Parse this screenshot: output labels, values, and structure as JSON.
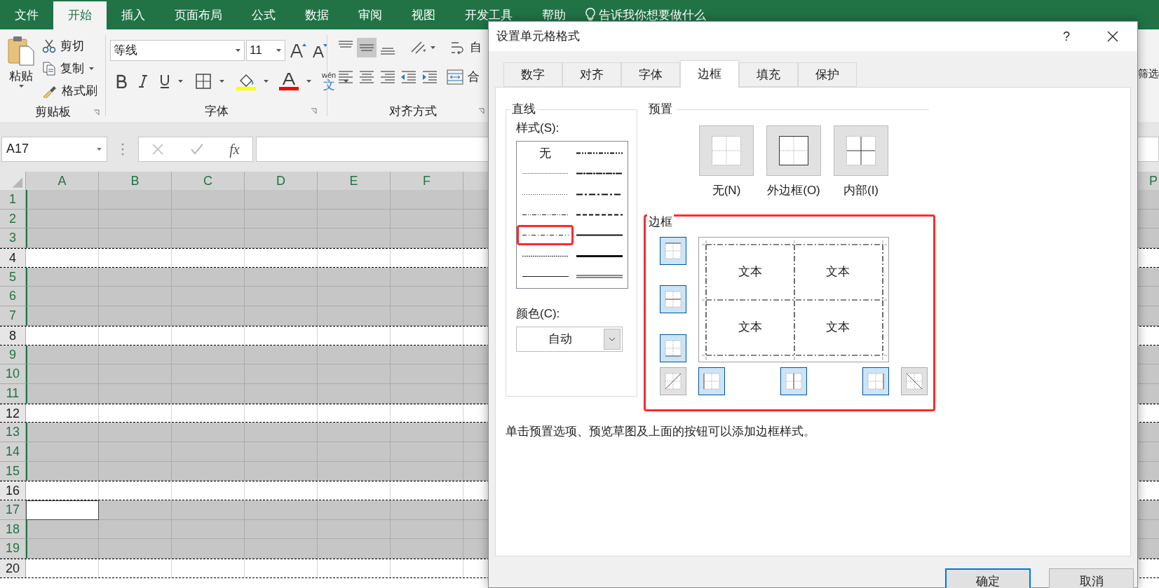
{
  "ribbon_tabs": [
    {
      "label": "文件",
      "selected": false
    },
    {
      "label": "开始",
      "selected": true
    },
    {
      "label": "插入",
      "selected": false
    },
    {
      "label": "页面布局",
      "selected": false
    },
    {
      "label": "公式",
      "selected": false
    },
    {
      "label": "数据",
      "selected": false
    },
    {
      "label": "审阅",
      "selected": false
    },
    {
      "label": "视图",
      "selected": false
    },
    {
      "label": "开发工具",
      "selected": false
    },
    {
      "label": "帮助",
      "selected": false
    }
  ],
  "tell_me": "告诉我你想要做什么",
  "ribbon": {
    "clipboard": {
      "paste": "粘贴",
      "cut": "剪切",
      "copy": "复制",
      "format_painter": "格式刷",
      "label": "剪贴板"
    },
    "font": {
      "name": "等线",
      "size": "11",
      "phonetic_top": "wén",
      "phonetic_char": "文",
      "label": "字体"
    },
    "alignment": {
      "wrap": "自",
      "merge": "合",
      "label": "对齐方式"
    },
    "right_edge": "筛选"
  },
  "name_box": "A17",
  "formula_bar": {
    "fx": "fx"
  },
  "sheet": {
    "columns": [
      "A",
      "B",
      "C",
      "D",
      "E",
      "F"
    ],
    "right_column": "P",
    "rows": [
      {
        "number": "1",
        "shaded": true,
        "active": false
      },
      {
        "number": "2",
        "shaded": true,
        "active": false
      },
      {
        "number": "3",
        "shaded": true,
        "active": false
      },
      {
        "number": "4",
        "shaded": false,
        "active": false
      },
      {
        "number": "5",
        "shaded": true,
        "active": false
      },
      {
        "number": "6",
        "shaded": true,
        "active": false
      },
      {
        "number": "7",
        "shaded": true,
        "active": false
      },
      {
        "number": "8",
        "shaded": false,
        "active": false
      },
      {
        "number": "9",
        "shaded": true,
        "active": false
      },
      {
        "number": "10",
        "shaded": true,
        "active": false
      },
      {
        "number": "11",
        "shaded": true,
        "active": false
      },
      {
        "number": "12",
        "shaded": false,
        "active": false
      },
      {
        "number": "13",
        "shaded": true,
        "active": false
      },
      {
        "number": "14",
        "shaded": true,
        "active": false
      },
      {
        "number": "15",
        "shaded": true,
        "active": false
      },
      {
        "number": "16",
        "shaded": false,
        "active": false
      },
      {
        "number": "17",
        "shaded": true,
        "active": true
      },
      {
        "number": "18",
        "shaded": true,
        "active": false
      },
      {
        "number": "19",
        "shaded": true,
        "active": false
      },
      {
        "number": "20",
        "shaded": false,
        "active": false
      }
    ]
  },
  "dialog": {
    "title": "设置单元格格式",
    "help": "?",
    "tabs": [
      {
        "label": "数字",
        "selected": false
      },
      {
        "label": "对齐",
        "selected": false
      },
      {
        "label": "字体",
        "selected": false
      },
      {
        "label": "边框",
        "selected": true
      },
      {
        "label": "填充",
        "selected": false
      },
      {
        "label": "保护",
        "selected": false
      }
    ],
    "line_group": {
      "label": "直线",
      "style_label": "样式(S):",
      "styles": [
        {
          "kind": "none",
          "label": "无",
          "selected": false
        },
        {
          "kind": "hair",
          "selected": false
        },
        {
          "kind": "dotted",
          "selected": false
        },
        {
          "kind": "dash-dot-dot",
          "selected": false
        },
        {
          "kind": "dash-dot",
          "selected": true
        },
        {
          "kind": "dashed",
          "selected": false
        },
        {
          "kind": "thin",
          "selected": false
        },
        {
          "kind": "medium-dash-dot-dot",
          "selected": false
        },
        {
          "kind": "slanted-dash-dot",
          "selected": false
        },
        {
          "kind": "medium-dash-dot",
          "selected": false
        },
        {
          "kind": "medium-dashed",
          "selected": false
        },
        {
          "kind": "medium",
          "selected": false
        },
        {
          "kind": "thick",
          "selected": false
        },
        {
          "kind": "double",
          "selected": false
        }
      ],
      "color_label": "颜色(C):",
      "color_value": "自动"
    },
    "presets": {
      "label": "预置",
      "items": [
        {
          "kind": "none",
          "label": "无(N)"
        },
        {
          "kind": "outline",
          "label": "外边框(O)"
        },
        {
          "kind": "inside",
          "label": "内部(I)"
        }
      ]
    },
    "border": {
      "label": "边框",
      "highlighted": true,
      "side_buttons": [
        {
          "kind": "top",
          "on": true
        },
        {
          "kind": "middle-h",
          "on": true
        },
        {
          "kind": "bottom",
          "on": true
        }
      ],
      "bottom_buttons": [
        {
          "kind": "diagonal-up",
          "on": false
        },
        {
          "kind": "left",
          "on": true
        },
        {
          "kind": "middle-v",
          "on": true
        },
        {
          "kind": "right",
          "on": true
        },
        {
          "kind": "diagonal-down",
          "on": false
        }
      ],
      "preview_texts": [
        "文本",
        "文本",
        "文本",
        "文本"
      ]
    },
    "hint": "单击预置选项、预览草图及上面的按钮可以添加边框样式。",
    "buttons": [
      {
        "label": "确定",
        "default": true
      },
      {
        "label": "取消",
        "default": false
      }
    ]
  }
}
